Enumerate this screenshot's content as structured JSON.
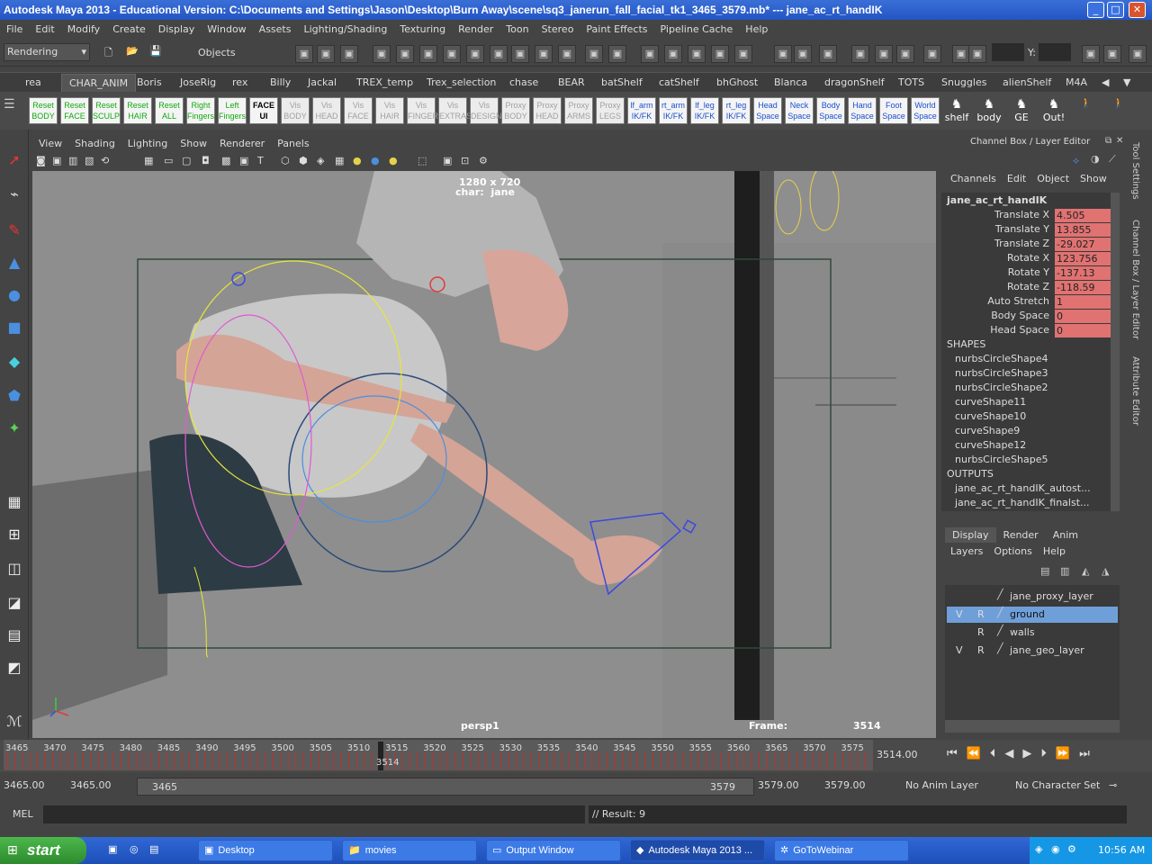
{
  "window": {
    "title": "Autodesk Maya 2013 - Educational Version: C:\\Documents and Settings\\Jason\\Desktop\\Burn Away\\scene\\sq3_janerun_fall_facial_tk1_3465_3579.mb*  ---  jane_ac_rt_handIK"
  },
  "menubar": [
    "File",
    "Edit",
    "Modify",
    "Create",
    "Display",
    "Window",
    "Assets",
    "Lighting/Shading",
    "Texturing",
    "Render",
    "Toon",
    "Stereo",
    "Paint Effects",
    "Pipeline Cache",
    "Help"
  ],
  "statusline": {
    "menuset": "Rendering",
    "objects_label": "Objects",
    "x_label": "X:",
    "y_label": "Y:"
  },
  "shelf_tabs": [
    "rea",
    "CHAR_ANIM",
    "Boris",
    "JoseRig",
    "rex",
    "Billy",
    "Jackal",
    "TREX_temp",
    "Trex_selection",
    "chase",
    "BEAR",
    "batShelf",
    "catShelf",
    "bhGhost",
    "Blanca",
    "dragonShelf",
    "TOTS",
    "Snuggles",
    "alienShelf",
    "M4A"
  ],
  "shelf_buttons": [
    {
      "l1": "Reset",
      "l2": "BODY",
      "style": "green"
    },
    {
      "l1": "Reset",
      "l2": "FACE",
      "style": "green"
    },
    {
      "l1": "Reset",
      "l2": "SCULP",
      "style": "green"
    },
    {
      "l1": "Reset",
      "l2": "HAIR",
      "style": "green"
    },
    {
      "l1": "Reset",
      "l2": "ALL",
      "style": "green"
    },
    {
      "l1": "Right",
      "l2": "Fingers",
      "style": "green"
    },
    {
      "l1": "Left",
      "l2": "Fingers",
      "style": "green"
    },
    {
      "l1": "FACE",
      "l2": "UI",
      "style": "black"
    },
    {
      "l1": "Vis",
      "l2": "BODY",
      "style": "gray"
    },
    {
      "l1": "Vis",
      "l2": "HEAD",
      "style": "gray"
    },
    {
      "l1": "Vis",
      "l2": "FACE",
      "style": "gray"
    },
    {
      "l1": "Vis",
      "l2": "HAIR",
      "style": "gray"
    },
    {
      "l1": "Vis",
      "l2": "FINGER",
      "style": "gray"
    },
    {
      "l1": "Vis",
      "l2": "EXTRAS",
      "style": "gray"
    },
    {
      "l1": "Vis",
      "l2": "DESIGN",
      "style": "gray"
    },
    {
      "l1": "Proxy",
      "l2": "BODY",
      "style": "gray"
    },
    {
      "l1": "Proxy",
      "l2": "HEAD",
      "style": "gray"
    },
    {
      "l1": "Proxy",
      "l2": "ARMS",
      "style": "gray"
    },
    {
      "l1": "Proxy",
      "l2": "LEGS",
      "style": "gray"
    },
    {
      "l1": "lf_arm",
      "l2": "IK/FK",
      "style": "blue"
    },
    {
      "l1": "rt_arm",
      "l2": "IK/FK",
      "style": "blue"
    },
    {
      "l1": "lf_leg",
      "l2": "IK/FK",
      "style": "blue"
    },
    {
      "l1": "rt_leg",
      "l2": "IK/FK",
      "style": "blue"
    },
    {
      "l1": "Head",
      "l2": "Space",
      "style": "blue"
    },
    {
      "l1": "Neck",
      "l2": "Space",
      "style": "blue"
    },
    {
      "l1": "Body",
      "l2": "Space",
      "style": "blue"
    },
    {
      "l1": "Hand",
      "l2": "Space",
      "style": "blue"
    },
    {
      "l1": "Foot",
      "l2": "Space",
      "style": "blue"
    },
    {
      "l1": "World",
      "l2": "Space",
      "style": "blue"
    }
  ],
  "shelf_icons": [
    "shelf",
    "body",
    "GE",
    "Out!"
  ],
  "panel_menu": [
    "View",
    "Shading",
    "Lighting",
    "Show",
    "Renderer",
    "Panels"
  ],
  "viewport": {
    "resolution": "1280 x 720",
    "char_label": "char:",
    "char_name": "jane",
    "camera": "persp1",
    "frame_label": "Frame:",
    "frame_value": "3514"
  },
  "channel_box": {
    "header": "Channel Box / Layer Editor",
    "menu": [
      "Channels",
      "Edit",
      "Object",
      "Show"
    ],
    "node": "jane_ac_rt_handIK",
    "channels": [
      {
        "name": "Translate X",
        "value": "4.505"
      },
      {
        "name": "Translate Y",
        "value": "13.855"
      },
      {
        "name": "Translate Z",
        "value": "-29.027"
      },
      {
        "name": "Rotate X",
        "value": "123.756"
      },
      {
        "name": "Rotate Y",
        "value": "-137.13"
      },
      {
        "name": "Rotate Z",
        "value": "-118.59"
      },
      {
        "name": "Auto Stretch",
        "value": "1"
      },
      {
        "name": "Body Space",
        "value": "0"
      },
      {
        "name": "Head Space",
        "value": "0"
      }
    ],
    "shapes_header": "SHAPES",
    "shapes": [
      "nurbsCircleShape4",
      "nurbsCircleShape3",
      "nurbsCircleShape2",
      "curveShape11",
      "curveShape10",
      "curveShape9",
      "curveShape12",
      "nurbsCircleShape5"
    ],
    "outputs_header": "OUTPUTS",
    "outputs": [
      "jane_ac_rt_handIK_autost...",
      "jane_ac_rt_handIK_finalst..."
    ]
  },
  "layer_editor": {
    "tabs": [
      "Display",
      "Render",
      "Anim"
    ],
    "menu": [
      "Layers",
      "Options",
      "Help"
    ],
    "layers": [
      {
        "v": "",
        "r": "",
        "name": "jane_proxy_layer",
        "selected": false
      },
      {
        "v": "V",
        "r": "R",
        "name": "ground",
        "selected": true
      },
      {
        "v": "",
        "r": "R",
        "name": "walls",
        "selected": false
      },
      {
        "v": "V",
        "r": "R",
        "name": "jane_geo_layer",
        "selected": false
      }
    ]
  },
  "side_tabs": [
    "Tool Settings",
    "Channel Box / Layer Editor",
    "Attribute Editor"
  ],
  "timeline": {
    "ticks": [
      "3465",
      "3470",
      "3475",
      "3480",
      "3485",
      "3490",
      "3495",
      "3500",
      "3505",
      "3510",
      "3515",
      "3520",
      "3525",
      "3530",
      "3535",
      "3540",
      "3545",
      "3550",
      "3555",
      "3560",
      "3565",
      "3570",
      "3575"
    ],
    "current_marker": "3514",
    "current_field": "3514.00",
    "start_time": "3465.00",
    "playback_start": "3465.00",
    "range_start": "3465",
    "range_end": "3579",
    "playback_end": "3579.00",
    "end_time": "3579.00",
    "anim_layer": "No Anim Layer",
    "char_set": "No Character Set"
  },
  "cmdline": {
    "label": "MEL",
    "result": "// Result: 9"
  },
  "taskbar": {
    "start": "start",
    "items": [
      "Desktop",
      "movies",
      "Output Window",
      "Autodesk Maya 2013 ...",
      "GoToWebinar"
    ],
    "clock": "10:56 AM"
  },
  "colors": {
    "channel_highlight": "#e07272",
    "taskbar": "#2455c3",
    "viewport_bg": "#8f8f8f"
  }
}
